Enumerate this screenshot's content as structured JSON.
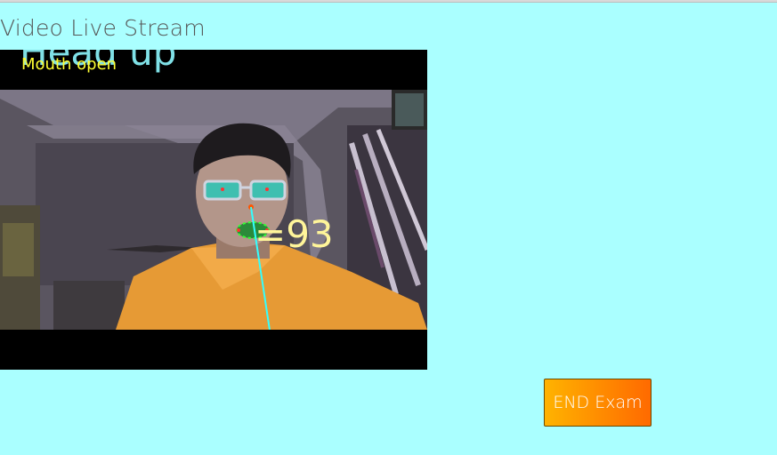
{
  "page": {
    "title": "Video Live Stream"
  },
  "stream": {
    "head_status": "Head up",
    "mouth_status": "Mouth open",
    "angle_readout": "=93"
  },
  "actions": {
    "end_exam_label": "END Exam"
  },
  "colors": {
    "page_background": "#aaffff",
    "button_gradient_start": "#ffb300",
    "button_gradient_end": "#ff6a00",
    "head_status_text": "#7fe0e6",
    "mouth_status_text": "#ffff33",
    "landmark_green": "#33ff33",
    "gaze_line": "#33ffff"
  }
}
